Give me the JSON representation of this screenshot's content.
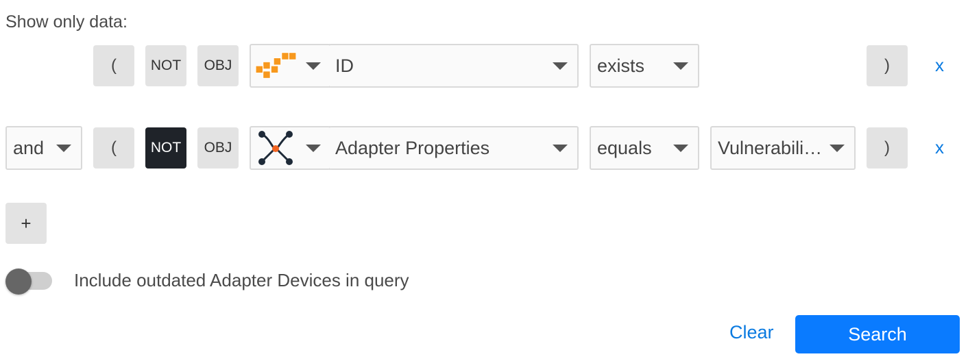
{
  "heading": "Show only data:",
  "rows": [
    {
      "open_paren": "(",
      "not_label": "NOT",
      "obj_label": "OBJ",
      "adapter_icon": "aws-cubes-icon",
      "field": "ID",
      "operator": "exists",
      "close_paren": ")",
      "remove_label": "x"
    },
    {
      "logic": "and",
      "open_paren": "(",
      "not_label": "NOT",
      "obj_label": "OBJ",
      "adapter_icon": "adapters-network-icon",
      "field": "Adapter Properties",
      "operator": "equals",
      "value": "Vulnerabili…",
      "close_paren": ")",
      "remove_label": "x"
    }
  ],
  "add_label": "+",
  "toggle_label": "Include outdated Adapter Devices in query",
  "clear_label": "Clear",
  "search_label": "Search",
  "colors": {
    "accent": "#0a7bff",
    "link": "#0a7ae0",
    "not_active": "#1f2329",
    "aws_orange": "#f7981d",
    "node_orange": "#f26522"
  }
}
